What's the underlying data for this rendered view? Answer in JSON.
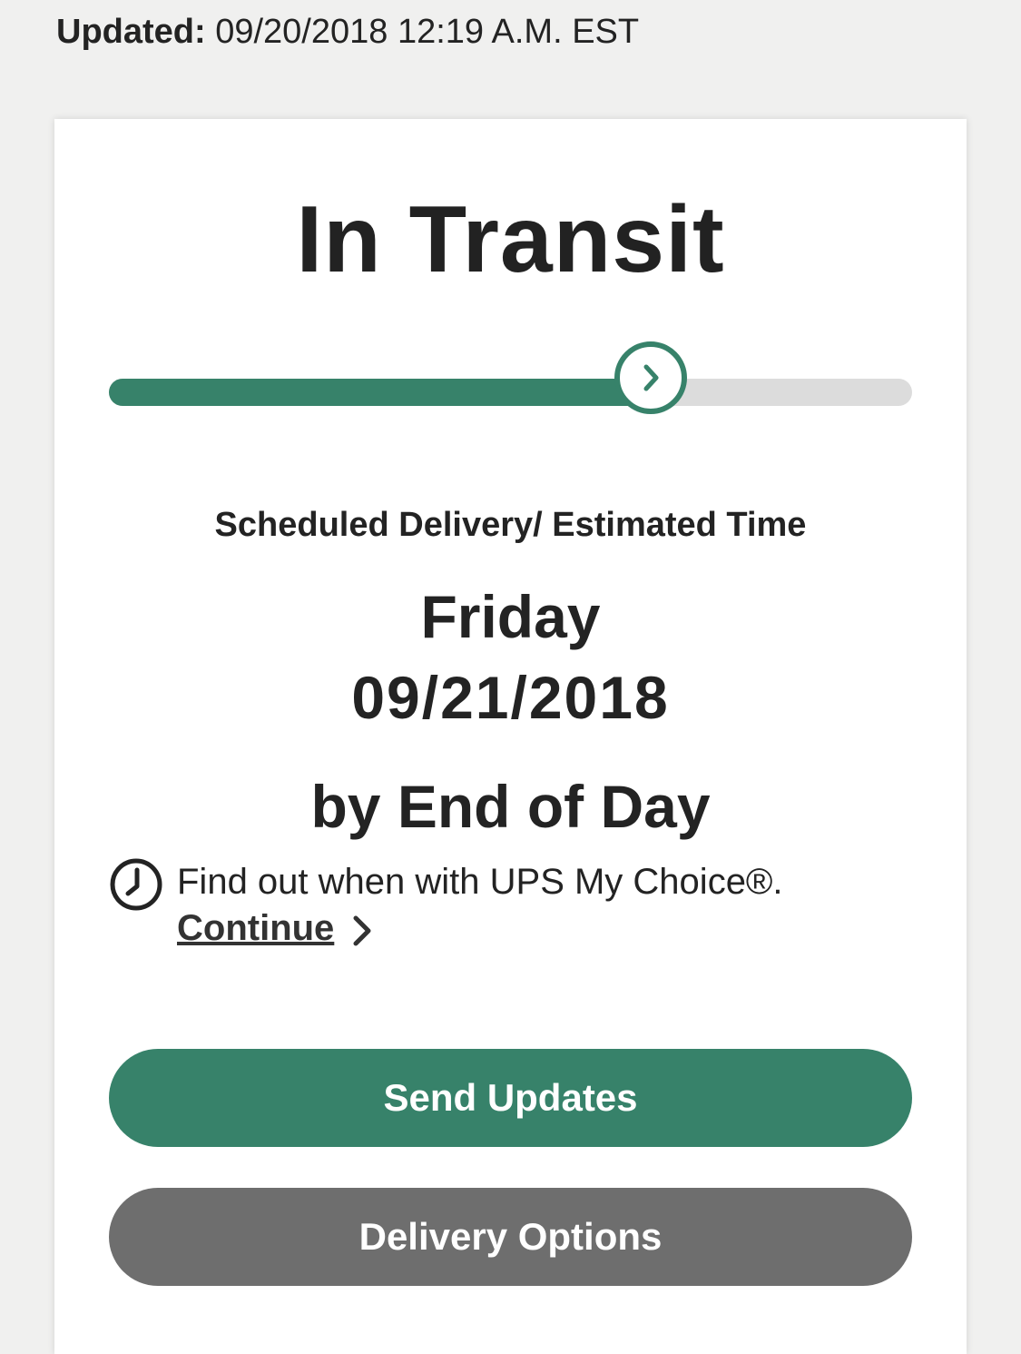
{
  "header": {
    "updated_label": "Updated:",
    "updated_value": "09/20/2018 12:19 A.M. EST"
  },
  "status": {
    "title": "In Transit",
    "progress_fraction": 0.675
  },
  "delivery": {
    "label": "Scheduled Delivery/ Estimated Time",
    "day": "Friday",
    "date": "09/21/2018",
    "window": "by End of Day"
  },
  "my_choice": {
    "text": "Find out when with UPS My Choice®.",
    "link_label": "Continue"
  },
  "actions": {
    "send_updates": "Send Updates",
    "delivery_options": "Delivery Options"
  },
  "colors": {
    "accent": "#37826a",
    "secondary_button": "#6e6e6e",
    "track": "#dcdcdc"
  },
  "icons": {
    "progress_knob": "chevron-right-icon",
    "my_choice": "clock-icon",
    "continue": "chevron-right-icon"
  }
}
